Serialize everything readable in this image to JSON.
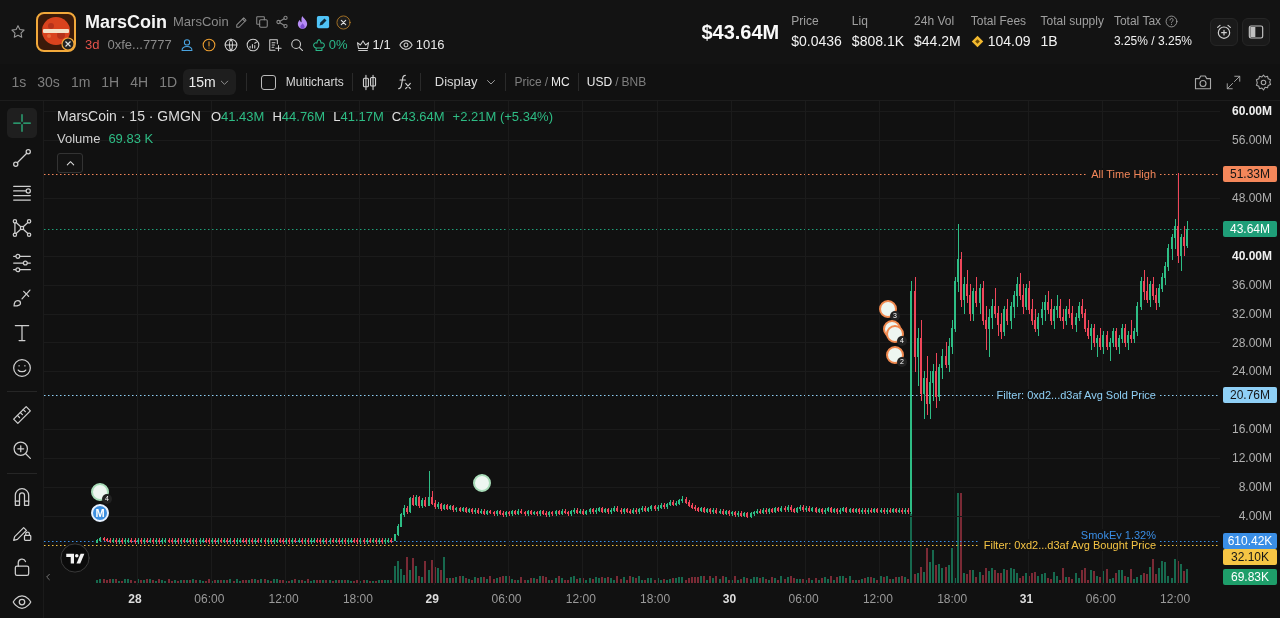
{
  "token": {
    "name": "MarsCoin",
    "symbol": "MarsCoin",
    "age": "3d",
    "address": "0xfe...7777",
    "holding_share": "0%",
    "ratio": "1/1",
    "views": "1016"
  },
  "market_cap": "$43.64M",
  "stats": [
    {
      "label": "Price",
      "value": "$0.0436"
    },
    {
      "label": "Liq",
      "value": "$808.1K"
    },
    {
      "label": "24h Vol",
      "value": "$44.2M"
    },
    {
      "label": "Total Fees",
      "value": "104.09",
      "kind": "coin"
    },
    {
      "label": "Total supply",
      "value": "1B"
    },
    {
      "label": "Total Tax",
      "value": "3.25% / 3.25%",
      "kind": "help"
    }
  ],
  "intervals": [
    {
      "label": "1s",
      "selected": false
    },
    {
      "label": "30s",
      "selected": false
    },
    {
      "label": "1m",
      "selected": false
    },
    {
      "label": "1H",
      "selected": false
    },
    {
      "label": "4H",
      "selected": false
    },
    {
      "label": "1D",
      "selected": false
    },
    {
      "label": "15m",
      "selected": true
    }
  ],
  "toolbar": {
    "multicharts": {
      "label": "Multicharts",
      "checked": false
    },
    "display": "Display",
    "price_mode": {
      "options": [
        {
          "label": "Price",
          "selected": false
        },
        {
          "label": "MC",
          "selected": true
        }
      ],
      "separator": "/"
    },
    "currency": {
      "options": [
        {
          "label": "USD",
          "selected": true
        },
        {
          "label": "BNB",
          "selected": false
        }
      ],
      "separator": "/"
    }
  },
  "drawing_tools": [
    {
      "selected": true
    },
    {
      "selected": false
    },
    {
      "selected": false
    },
    {
      "selected": false
    },
    {
      "selected": false
    },
    {
      "selected": false
    },
    {
      "selected": false
    },
    {
      "selected": false
    },
    {
      "selected": false
    },
    {
      "selected": false
    },
    {
      "selected": false
    },
    {
      "selected": false
    },
    {
      "selected": false
    },
    {
      "selected": false
    }
  ],
  "price_axis": [
    {
      "major": true
    },
    {
      "major": false
    },
    {
      "major": false
    },
    {
      "major": true
    },
    {
      "major": false
    },
    {
      "major": false
    },
    {
      "major": false
    },
    {
      "major": false
    },
    {
      "major": false
    },
    {
      "major": false
    },
    {
      "major": false
    },
    {
      "major": false
    }
  ],
  "time_axis": [
    {
      "major": true
    },
    {
      "major": false
    },
    {
      "major": false
    },
    {
      "major": false
    },
    {
      "major": true
    },
    {
      "major": false
    },
    {
      "major": false
    },
    {
      "major": false
    },
    {
      "major": true
    },
    {
      "major": false
    },
    {
      "major": false
    },
    {
      "major": false
    },
    {
      "major": true
    },
    {
      "major": false
    },
    {
      "major": false
    }
  ],
  "chart": {
    "legend": {
      "title": "MarsCoin · 15 · GMGN",
      "ohlc": [
        {
          "key": "O",
          "value": "41.43M"
        },
        {
          "key": "H",
          "value": "44.76M"
        },
        {
          "key": "L",
          "value": "41.17M"
        },
        {
          "key": "C",
          "value": "43.64M"
        }
      ],
      "change": "+2.21M (+5.34%)",
      "volume_label": "Volume",
      "volume_value": "69.83 K"
    },
    "chart_data": {
      "type": "candlestick",
      "grid": true,
      "ylim": [
        -5.53,
        61.39
      ],
      "yticks": [
        {
          "value": 60,
          "label": "60.00M"
        },
        {
          "value": 56,
          "label": "56.00M"
        },
        {
          "value": 48,
          "label": "48.00M"
        },
        {
          "value": 40,
          "label": "40.00M"
        },
        {
          "value": 36,
          "label": "36.00M"
        },
        {
          "value": 32,
          "label": "32.00M"
        },
        {
          "value": 28,
          "label": "28.00M"
        },
        {
          "value": 24,
          "label": "24.00M"
        },
        {
          "value": 16,
          "label": "16.00M"
        },
        {
          "value": 12,
          "label": "12.00M"
        },
        {
          "value": 8,
          "label": "8.00M"
        },
        {
          "value": 4,
          "label": "4.00M"
        }
      ],
      "categories": [
        null,
        null,
        null,
        null,
        null,
        null,
        null,
        null,
        null,
        null,
        null,
        null,
        "28",
        null,
        null,
        null,
        null,
        null,
        null,
        null,
        null,
        null,
        null,
        null,
        null,
        null,
        null,
        null,
        null,
        null,
        null,
        null,
        null,
        null,
        null,
        null,
        "06:00",
        null,
        null,
        null,
        null,
        null,
        null,
        null,
        null,
        null,
        null,
        null,
        null,
        null,
        null,
        null,
        null,
        null,
        null,
        null,
        null,
        null,
        null,
        null,
        "12:00",
        null,
        null,
        null,
        null,
        null,
        null,
        null,
        null,
        null,
        null,
        null,
        null,
        null,
        null,
        null,
        null,
        null,
        null,
        null,
        null,
        null,
        null,
        null,
        "18:00",
        null,
        null,
        null,
        null,
        null,
        null,
        null,
        null,
        null,
        null,
        null,
        null,
        null,
        null,
        null,
        null,
        null,
        null,
        null,
        null,
        null,
        null,
        null,
        "29",
        null,
        null,
        null,
        null,
        null,
        null,
        null,
        null,
        null,
        null,
        null,
        null,
        null,
        null,
        null,
        null,
        null,
        null,
        null,
        null,
        null,
        null,
        null,
        "06:00",
        null,
        null,
        null,
        null,
        null,
        null,
        null,
        null,
        null,
        null,
        null,
        null,
        null,
        null,
        null,
        null,
        null,
        null,
        null,
        null,
        null,
        null,
        null,
        "12:00",
        null,
        null,
        null,
        null,
        null,
        null,
        null,
        null,
        null,
        null,
        null,
        null,
        null,
        null,
        null,
        null,
        null,
        null,
        null,
        null,
        null,
        null,
        null,
        "18:00",
        null,
        null,
        null,
        null,
        null,
        null,
        null,
        null,
        null,
        null,
        null,
        null,
        null,
        null,
        null,
        null,
        null,
        null,
        null,
        null,
        null,
        null,
        null,
        "30",
        null,
        null,
        null,
        null,
        null,
        null,
        null,
        null,
        null,
        null,
        null,
        null,
        null,
        null,
        null,
        null,
        null,
        null,
        null,
        null,
        null,
        null,
        null,
        "06:00",
        null,
        null,
        null,
        null,
        null,
        null,
        null,
        null,
        null,
        null,
        null,
        null,
        null,
        null,
        null,
        null,
        null,
        null,
        null,
        null,
        null,
        null,
        null,
        "12:00",
        null,
        null,
        null,
        null,
        null,
        null,
        null,
        null,
        null,
        null,
        null,
        null,
        null,
        null,
        null,
        null,
        null,
        null,
        null,
        null,
        null,
        null,
        null,
        "18:00",
        null,
        null,
        null,
        null,
        null,
        null,
        null,
        null,
        null,
        null,
        null,
        null,
        null,
        null,
        null,
        null,
        null,
        null,
        null,
        null,
        null,
        null,
        null,
        "31",
        null,
        null,
        null,
        null,
        null,
        null,
        null,
        null,
        null,
        null,
        null,
        null,
        null,
        null,
        null,
        null,
        null,
        null,
        null,
        null,
        null,
        null,
        null,
        "06:00",
        null,
        null,
        null,
        null,
        null,
        null,
        null,
        null,
        null,
        null,
        null,
        null,
        null,
        null,
        null,
        null,
        null,
        null,
        null,
        null,
        null,
        null,
        null,
        "12:00",
        null,
        null,
        null,
        null
      ],
      "ohlc": [
        [
          0.4,
          0.8,
          0.3,
          0.6
        ],
        [
          0.6,
          1.1,
          0.5,
          0.88
        ],
        [
          0.88,
          1.1,
          0.6,
          0.74
        ],
        [
          0.74,
          0.95,
          0.45,
          0.59
        ],
        [
          0.59,
          0.89,
          0.28,
          0.58
        ],
        [
          0.58,
          0.91,
          0.28,
          0.61
        ],
        [
          0.61,
          0.91,
          0.27,
          0.57
        ],
        [
          0.57,
          0.9,
          0.27,
          0.6
        ],
        [
          0.6,
          0.9,
          0.25,
          0.55
        ],
        [
          0.55,
          0.89,
          0.25,
          0.59
        ],
        [
          0.59,
          0.92,
          0.29,
          0.62
        ],
        [
          0.62,
          0.92,
          0.28,
          0.58
        ],
        [
          0.58,
          0.88,
          0.26,
          0.56
        ],
        [
          0.56,
          0.9,
          0.26,
          0.6
        ],
        [
          0.6,
          0.9,
          0.27,
          0.57
        ],
        [
          0.57,
          0.89,
          0.27,
          0.59
        ],
        [
          0.59,
          0.89,
          0.28,
          0.58
        ],
        [
          0.58,
          0.91,
          0.28,
          0.61
        ],
        [
          0.61,
          0.91,
          0.27,
          0.57
        ],
        [
          0.57,
          0.9,
          0.27,
          0.6
        ],
        [
          0.6,
          0.9,
          0.25,
          0.55
        ],
        [
          0.55,
          0.89,
          0.25,
          0.59
        ],
        [
          0.59,
          0.92,
          0.29,
          0.62
        ],
        [
          0.62,
          0.92,
          0.28,
          0.58
        ],
        [
          0.58,
          0.88,
          0.26,
          0.56
        ],
        [
          0.56,
          0.9,
          0.26,
          0.6
        ],
        [
          0.6,
          0.9,
          0.27,
          0.57
        ],
        [
          0.57,
          0.89,
          0.27,
          0.59
        ],
        [
          0.59,
          0.89,
          0.28,
          0.58
        ],
        [
          0.58,
          0.91,
          0.28,
          0.61
        ],
        [
          0.61,
          0.91,
          0.27,
          0.57
        ],
        [
          0.57,
          0.9,
          0.27,
          0.6
        ],
        [
          0.6,
          0.9,
          0.25,
          0.55
        ],
        [
          0.55,
          0.89,
          0.25,
          0.59
        ],
        [
          0.59,
          0.92,
          0.29,
          0.62
        ],
        [
          0.62,
          0.92,
          0.28,
          0.58
        ],
        [
          0.58,
          0.88,
          0.26,
          0.56
        ],
        [
          0.56,
          0.9,
          0.26,
          0.6
        ],
        [
          0.6,
          0.9,
          0.27,
          0.57
        ],
        [
          0.57,
          0.89,
          0.27,
          0.59
        ],
        [
          0.59,
          0.89,
          0.28,
          0.58
        ],
        [
          0.58,
          0.91,
          0.28,
          0.61
        ],
        [
          0.61,
          0.91,
          0.27,
          0.57
        ],
        [
          0.57,
          0.9,
          0.27,
          0.6
        ],
        [
          0.6,
          0.9,
          0.25,
          0.55
        ],
        [
          0.55,
          0.89,
          0.25,
          0.59
        ],
        [
          0.59,
          0.92,
          0.29,
          0.62
        ],
        [
          0.62,
          0.92,
          0.28,
          0.58
        ],
        [
          0.58,
          0.88,
          0.26,
          0.56
        ],
        [
          0.56,
          0.9,
          0.26,
          0.6
        ],
        [
          0.6,
          0.9,
          0.27,
          0.57
        ],
        [
          0.57,
          0.89,
          0.27,
          0.59
        ],
        [
          0.59,
          0.89,
          0.28,
          0.58
        ],
        [
          0.58,
          0.91,
          0.28,
          0.61
        ],
        [
          0.61,
          0.91,
          0.27,
          0.57
        ],
        [
          0.57,
          0.9,
          0.27,
          0.6
        ],
        [
          0.6,
          0.9,
          0.25,
          0.55
        ],
        [
          0.55,
          0.89,
          0.25,
          0.59
        ],
        [
          0.59,
          0.92,
          0.29,
          0.62
        ],
        [
          0.62,
          0.92,
          0.28,
          0.58
        ],
        [
          0.58,
          0.88,
          0.26,
          0.56
        ],
        [
          0.56,
          0.9,
          0.26,
          0.6
        ],
        [
          0.6,
          0.9,
          0.27,
          0.57
        ],
        [
          0.57,
          0.89,
          0.27,
          0.59
        ],
        [
          0.59,
          0.89,
          0.28,
          0.58
        ],
        [
          0.58,
          0.91,
          0.28,
          0.61
        ],
        [
          0.61,
          0.91,
          0.27,
          0.57
        ],
        [
          0.57,
          0.9,
          0.27,
          0.6
        ],
        [
          0.6,
          0.9,
          0.25,
          0.55
        ],
        [
          0.55,
          0.89,
          0.25,
          0.59
        ],
        [
          0.59,
          0.92,
          0.29,
          0.62
        ],
        [
          0.62,
          0.92,
          0.28,
          0.58
        ],
        [
          0.58,
          0.88,
          0.26,
          0.56
        ],
        [
          0.56,
          0.9,
          0.26,
          0.6
        ],
        [
          0.6,
          0.9,
          0.27,
          0.57
        ],
        [
          0.57,
          0.89,
          0.27,
          0.59
        ],
        [
          0.59,
          0.89,
          0.28,
          0.58
        ],
        [
          0.58,
          0.91,
          0.28,
          0.61
        ],
        [
          0.61,
          0.91,
          0.27,
          0.57
        ],
        [
          0.57,
          0.9,
          0.27,
          0.6
        ],
        [
          0.6,
          0.9,
          0.25,
          0.55
        ],
        [
          0.55,
          0.89,
          0.25,
          0.59
        ],
        [
          0.59,
          0.92,
          0.29,
          0.62
        ],
        [
          0.62,
          0.92,
          0.28,
          0.58
        ],
        [
          0.58,
          0.88,
          0.26,
          0.56
        ],
        [
          0.56,
          0.9,
          0.26,
          0.6
        ],
        [
          0.6,
          0.9,
          0.27,
          0.57
        ],
        [
          0.57,
          0.89,
          0.27,
          0.59
        ],
        [
          0.59,
          0.89,
          0.28,
          0.58
        ],
        [
          0.58,
          0.91,
          0.28,
          0.61
        ],
        [
          0.61,
          0.91,
          0.27,
          0.57
        ],
        [
          0.57,
          0.9,
          0.27,
          0.6
        ],
        [
          0.6,
          0.9,
          0.25,
          0.55
        ],
        [
          0.55,
          0.89,
          0.25,
          0.59
        ],
        [
          0.59,
          0.92,
          0.29,
          0.62
        ],
        [
          0.62,
          0.92,
          0.28,
          0.58
        ],
        [
          0.58,
          1.5,
          0.56,
          1.4
        ],
        [
          1.4,
          2.8,
          1.3,
          2.6
        ],
        [
          2.6,
          4.4,
          2.5,
          4.2
        ],
        [
          4.2,
          5.4,
          4.0,
          5.1
        ],
        [
          5.1,
          5.3,
          4.3,
          4.6
        ],
        [
          4.6,
          6.6,
          4.5,
          6.4
        ],
        [
          6.4,
          6.9,
          5.4,
          5.6
        ],
        [
          5.6,
          6.8,
          5.4,
          6.5
        ],
        [
          6.5,
          6.7,
          5.2,
          5.4
        ],
        [
          5.4,
          6.4,
          5.2,
          6.2
        ],
        [
          6.2,
          6.5,
          5.3,
          5.5
        ],
        [
          5.5,
          10.2,
          5.4,
          6.6
        ],
        [
          6.6,
          7.4,
          5.6,
          5.8
        ],
        [
          5.8,
          6.1,
          5.1,
          5.3
        ],
        [
          5.3,
          5.9,
          5.1,
          5.6
        ],
        [
          5.6,
          5.8,
          4.8,
          5.0
        ],
        [
          5.0,
          5.6,
          4.9,
          5.4
        ],
        [
          5.4,
          5.6,
          4.9,
          5.1
        ],
        [
          5.1,
          5.5,
          4.9,
          5.3
        ],
        [
          5.3,
          5.5,
          4.7,
          4.9
        ],
        [
          4.9,
          5.2,
          4.7,
          5.0
        ],
        [
          5.0,
          5.2,
          4.6,
          4.8
        ],
        [
          4.8,
          5.2,
          4.6,
          5.0
        ],
        [
          5.0,
          5.2,
          4.5,
          4.7
        ],
        [
          4.7,
          5.1,
          4.5,
          4.9
        ],
        [
          4.9,
          5.1,
          4.4,
          4.6
        ],
        [
          4.6,
          5.0,
          4.4,
          4.8
        ],
        [
          4.8,
          5.0,
          4.3,
          4.5
        ],
        [
          4.5,
          4.9,
          4.3,
          4.7
        ],
        [
          4.7,
          4.9,
          4.2,
          4.4
        ],
        [
          4.4,
          4.8,
          4.2,
          4.6
        ],
        [
          4.6,
          4.8,
          4.3,
          4.5
        ],
        [
          4.5,
          4.7,
          4.1,
          4.3
        ],
        [
          4.3,
          4.8,
          4.1,
          4.6
        ],
        [
          4.6,
          4.8,
          4.2,
          4.4
        ],
        [
          4.4,
          4.6,
          4.0,
          4.2
        ],
        [
          4.2,
          4.7,
          4.0,
          4.5
        ],
        [
          4.5,
          4.7,
          4.1,
          4.3
        ],
        [
          4.3,
          4.8,
          4.1,
          4.6
        ],
        [
          4.6,
          4.8,
          4.2,
          4.4
        ],
        [
          4.4,
          4.9,
          4.2,
          4.7
        ],
        [
          4.7,
          4.9,
          4.3,
          4.5
        ],
        [
          4.5,
          4.7,
          4.1,
          4.3
        ],
        [
          4.3,
          4.8,
          4.1,
          4.6
        ],
        [
          4.6,
          4.8,
          4.2,
          4.4
        ],
        [
          4.4,
          4.7,
          4.2,
          4.5
        ],
        [
          4.5,
          4.7,
          4.1,
          4.3
        ],
        [
          4.3,
          4.8,
          4.1,
          4.6
        ],
        [
          4.6,
          4.8,
          4.2,
          4.4
        ],
        [
          4.4,
          4.6,
          4.0,
          4.2
        ],
        [
          4.2,
          4.7,
          4.0,
          4.5
        ],
        [
          4.5,
          4.7,
          4.1,
          4.3
        ],
        [
          4.3,
          4.8,
          4.1,
          4.6
        ],
        [
          4.6,
          4.8,
          4.2,
          4.4
        ],
        [
          4.4,
          4.9,
          4.2,
          4.7
        ],
        [
          4.7,
          4.9,
          4.3,
          4.5
        ],
        [
          4.5,
          4.7,
          4.1,
          4.3
        ],
        [
          4.3,
          4.8,
          4.1,
          4.6
        ],
        [
          4.6,
          5.0,
          4.4,
          4.8
        ],
        [
          4.8,
          5.0,
          4.3,
          4.5
        ],
        [
          4.5,
          4.9,
          4.3,
          4.7
        ],
        [
          4.7,
          4.9,
          4.2,
          4.4
        ],
        [
          4.4,
          4.8,
          4.2,
          4.6
        ],
        [
          4.6,
          5.1,
          4.4,
          4.9
        ],
        [
          4.9,
          5.1,
          4.4,
          4.6
        ],
        [
          4.6,
          5.0,
          4.4,
          4.8
        ],
        [
          4.8,
          5.2,
          4.6,
          5.0
        ],
        [
          5.0,
          5.2,
          4.5,
          4.7
        ],
        [
          4.7,
          5.1,
          4.5,
          4.9
        ],
        [
          4.9,
          5.1,
          4.4,
          4.6
        ],
        [
          4.6,
          5.0,
          4.4,
          4.8
        ],
        [
          4.8,
          5.3,
          4.6,
          5.1
        ],
        [
          5.1,
          5.3,
          4.6,
          4.8
        ],
        [
          4.8,
          5.0,
          4.4,
          4.6
        ],
        [
          4.6,
          5.1,
          4.4,
          4.9
        ],
        [
          4.9,
          5.1,
          4.5,
          4.7
        ],
        [
          4.7,
          4.9,
          4.3,
          4.5
        ],
        [
          4.5,
          5.0,
          4.3,
          4.8
        ],
        [
          4.8,
          5.0,
          4.4,
          4.6
        ],
        [
          4.6,
          5.1,
          4.4,
          4.9
        ],
        [
          4.9,
          5.3,
          4.7,
          5.1
        ],
        [
          5.1,
          5.3,
          4.6,
          4.8
        ],
        [
          4.8,
          5.2,
          4.6,
          5.0
        ],
        [
          5.0,
          5.5,
          4.8,
          5.3
        ],
        [
          5.3,
          5.5,
          4.8,
          5.0
        ],
        [
          5.0,
          5.4,
          4.8,
          5.2
        ],
        [
          5.2,
          5.7,
          5.0,
          5.5
        ],
        [
          5.5,
          5.7,
          5.1,
          5.3
        ],
        [
          5.3,
          5.8,
          5.1,
          5.6
        ],
        [
          5.6,
          6.1,
          5.4,
          5.9
        ],
        [
          5.9,
          6.1,
          5.4,
          5.6
        ],
        [
          5.6,
          6.0,
          5.4,
          5.8
        ],
        [
          5.8,
          6.3,
          5.6,
          6.1
        ],
        [
          6.1,
          6.7,
          5.9,
          6.3
        ],
        [
          6.3,
          6.5,
          5.7,
          5.9
        ],
        [
          5.9,
          6.1,
          5.3,
          5.5
        ],
        [
          5.5,
          5.7,
          5.0,
          5.2
        ],
        [
          5.2,
          5.4,
          4.8,
          5.0
        ],
        [
          5.0,
          5.2,
          4.6,
          4.8
        ],
        [
          4.8,
          5.2,
          4.6,
          5.0
        ],
        [
          5.0,
          5.2,
          4.5,
          4.7
        ],
        [
          4.7,
          5.1,
          4.5,
          4.9
        ],
        [
          4.9,
          5.1,
          4.4,
          4.6
        ],
        [
          4.6,
          5.0,
          4.4,
          4.8
        ],
        [
          4.8,
          5.0,
          4.3,
          4.5
        ],
        [
          4.5,
          4.9,
          4.3,
          4.7
        ],
        [
          4.7,
          4.9,
          4.2,
          4.4
        ],
        [
          4.4,
          4.8,
          4.2,
          4.6
        ],
        [
          4.6,
          4.8,
          4.1,
          4.3
        ],
        [
          4.3,
          4.7,
          4.1,
          4.5
        ],
        [
          4.5,
          4.7,
          4.0,
          4.2
        ],
        [
          4.2,
          4.6,
          4.0,
          4.4
        ],
        [
          4.4,
          4.6,
          3.9,
          4.1
        ],
        [
          4.1,
          4.5,
          3.9,
          4.3
        ],
        [
          4.3,
          4.5,
          3.8,
          4.0
        ],
        [
          4.0,
          4.5,
          3.8,
          4.3
        ],
        [
          4.3,
          4.7,
          4.1,
          4.5
        ],
        [
          4.5,
          4.9,
          4.3,
          4.7
        ],
        [
          4.7,
          4.9,
          4.3,
          4.5
        ],
        [
          4.5,
          5.0,
          4.3,
          4.8
        ],
        [
          4.8,
          5.0,
          4.4,
          4.6
        ],
        [
          4.6,
          5.1,
          4.4,
          4.9
        ],
        [
          4.9,
          5.1,
          4.5,
          4.7
        ],
        [
          4.7,
          5.2,
          4.5,
          5.0
        ],
        [
          5.0,
          5.2,
          4.6,
          4.8
        ],
        [
          4.8,
          5.3,
          4.6,
          5.1
        ],
        [
          5.1,
          5.3,
          4.7,
          4.9
        ],
        [
          4.9,
          5.4,
          4.7,
          5.2
        ],
        [
          5.2,
          5.4,
          4.7,
          4.9
        ],
        [
          4.9,
          5.1,
          4.5,
          4.7
        ],
        [
          4.7,
          5.2,
          4.5,
          5.0
        ],
        [
          5.0,
          5.4,
          4.8,
          5.2
        ],
        [
          5.2,
          5.4,
          4.7,
          4.9
        ],
        [
          4.9,
          5.3,
          4.7,
          5.1
        ],
        [
          5.1,
          5.3,
          4.6,
          4.8
        ],
        [
          4.8,
          5.2,
          4.6,
          5.0
        ],
        [
          5.0,
          5.2,
          4.5,
          4.7
        ],
        [
          4.7,
          5.1,
          4.5,
          4.9
        ],
        [
          4.9,
          5.1,
          4.4,
          4.6
        ],
        [
          4.6,
          5.0,
          4.4,
          4.8
        ],
        [
          4.8,
          5.2,
          4.6,
          5.0
        ],
        [
          5.0,
          5.2,
          4.5,
          4.7
        ],
        [
          4.7,
          5.1,
          4.5,
          4.9
        ],
        [
          4.9,
          5.1,
          4.4,
          4.6
        ],
        [
          4.6,
          5.0,
          4.4,
          4.8
        ],
        [
          4.8,
          5.2,
          4.6,
          5.0
        ],
        [
          5.0,
          5.2,
          4.5,
          4.7
        ],
        [
          4.7,
          5.1,
          4.5,
          4.9
        ],
        [
          4.9,
          5.1,
          4.5,
          4.7
        ],
        [
          4.7,
          5.1,
          4.5,
          4.9
        ],
        [
          4.9,
          5.1,
          4.4,
          4.6
        ],
        [
          4.6,
          5.0,
          4.4,
          4.8
        ],
        [
          4.8,
          5.0,
          4.4,
          4.6
        ],
        [
          4.6,
          5.0,
          4.4,
          4.8
        ],
        [
          4.8,
          5.0,
          4.5,
          4.7
        ],
        [
          4.7,
          5.1,
          4.5,
          4.9
        ],
        [
          4.9,
          5.1,
          4.5,
          4.7
        ],
        [
          4.7,
          5.0,
          4.5,
          4.8
        ],
        [
          4.8,
          5.0,
          4.4,
          4.6
        ],
        [
          4.6,
          5.0,
          4.4,
          4.8
        ],
        [
          4.8,
          5.0,
          4.5,
          4.7
        ],
        [
          4.7,
          5.1,
          4.5,
          4.9
        ],
        [
          4.9,
          5.1,
          4.5,
          4.7
        ],
        [
          4.7,
          5.0,
          4.5,
          4.8
        ],
        [
          4.8,
          5.0,
          4.4,
          4.6
        ],
        [
          4.6,
          5.0,
          4.4,
          4.8
        ],
        [
          4.8,
          5.0,
          4.4,
          4.6
        ],
        [
          4.6,
          36.5,
          4.4,
          35
        ],
        [
          35,
          37,
          24,
          26
        ],
        [
          26,
          30,
          22,
          28.5
        ],
        [
          28.5,
          31,
          20,
          21
        ],
        [
          21,
          24,
          17.5,
          23
        ],
        [
          23,
          26,
          18,
          19.5
        ],
        [
          19.5,
          24,
          17.5,
          22.5
        ],
        [
          22.5,
          25,
          20,
          24
        ],
        [
          24,
          26.5,
          19,
          20.5
        ],
        [
          20.5,
          25,
          20,
          24.5
        ],
        [
          24.5,
          27,
          23,
          26
        ],
        [
          26,
          28,
          24.5,
          25
        ],
        [
          25,
          28.5,
          24,
          27.5
        ],
        [
          27.5,
          31,
          26.5,
          30
        ],
        [
          30,
          37,
          29.5,
          36.5
        ],
        [
          36.5,
          44.3,
          35,
          39.5
        ],
        [
          39.5,
          40.5,
          33,
          34
        ],
        [
          34,
          37,
          32,
          36
        ],
        [
          36,
          38,
          33.5,
          34.5
        ],
        [
          34.5,
          36,
          31,
          32
        ],
        [
          32,
          35.5,
          31,
          35
        ],
        [
          35,
          37,
          33,
          33.5
        ],
        [
          33.5,
          36,
          32,
          35.5
        ],
        [
          35.5,
          36.5,
          30.5,
          31
        ],
        [
          31,
          33,
          27,
          30
        ],
        [
          30,
          32.5,
          26,
          31.5
        ],
        [
          31.5,
          34,
          30,
          33
        ],
        [
          33,
          35.5,
          31.5,
          32
        ],
        [
          32,
          33,
          29,
          30.5
        ],
        [
          30.5,
          32,
          28.5,
          29.5
        ],
        [
          29.5,
          33,
          29,
          32.5
        ],
        [
          32.5,
          34,
          30.5,
          31
        ],
        [
          31,
          33.5,
          30,
          33
        ],
        [
          33,
          35,
          31.5,
          34.5
        ],
        [
          34.5,
          37,
          33,
          36
        ],
        [
          36,
          37.5,
          34,
          34.5
        ],
        [
          34.5,
          36,
          32,
          33
        ],
        [
          33,
          36,
          32.5,
          35.5
        ],
        [
          35.5,
          36.5,
          32,
          32.5
        ],
        [
          32.5,
          34,
          30.5,
          31
        ],
        [
          31,
          32.5,
          29.5,
          30
        ],
        [
          30,
          32,
          29,
          31.5
        ],
        [
          31.5,
          33.5,
          30.5,
          32.5
        ],
        [
          32.5,
          34.5,
          31,
          33.5
        ],
        [
          33.5,
          35,
          32,
          32.5
        ],
        [
          32.5,
          34,
          30.5,
          31
        ],
        [
          31,
          33,
          30,
          32.5
        ],
        [
          32.5,
          34.5,
          31.5,
          33
        ],
        [
          33,
          34,
          31,
          31.5
        ],
        [
          31.5,
          32.5,
          30,
          31
        ],
        [
          31,
          33,
          30.5,
          32.5
        ],
        [
          32.5,
          34,
          31.5,
          32
        ],
        [
          32,
          33,
          30,
          30.5
        ],
        [
          30.5,
          32,
          29.5,
          31.5
        ],
        [
          31.5,
          33.5,
          31,
          33
        ],
        [
          33,
          34,
          31.5,
          32
        ],
        [
          32,
          32.5,
          29.5,
          30
        ],
        [
          30,
          31,
          28.5,
          29
        ],
        [
          29,
          30.5,
          27,
          30
        ],
        [
          30,
          30.5,
          27.5,
          28
        ],
        [
          28,
          29,
          26,
          28.5
        ],
        [
          28.5,
          30,
          27,
          27.5
        ],
        [
          27.5,
          29.5,
          26.5,
          29
        ],
        [
          29,
          29.5,
          27,
          27.5
        ],
        [
          27.5,
          28.5,
          25.5,
          28
        ],
        [
          28,
          30,
          27.5,
          29.5
        ],
        [
          29.5,
          30,
          27,
          27.5
        ],
        [
          27.5,
          29,
          26.5,
          28.5
        ],
        [
          28.5,
          30.5,
          28,
          30
        ],
        [
          30,
          30.5,
          27.5,
          28
        ],
        [
          28,
          29.5,
          27,
          29
        ],
        [
          29,
          31,
          28,
          28.5
        ],
        [
          28.5,
          30,
          28,
          29.5
        ],
        [
          29.5,
          33.5,
          29,
          33
        ],
        [
          33,
          37,
          32.5,
          36.5
        ],
        [
          36.5,
          38,
          34,
          35
        ],
        [
          35,
          37,
          33.5,
          34
        ],
        [
          34,
          36.5,
          33,
          36
        ],
        [
          36,
          37,
          34,
          34.5
        ],
        [
          34.5,
          35.5,
          32.5,
          33.5
        ],
        [
          33.5,
          36,
          33,
          35.5
        ],
        [
          35.5,
          37.5,
          35,
          37
        ],
        [
          37,
          39,
          36,
          38.5
        ],
        [
          38.5,
          41.5,
          38,
          41
        ],
        [
          41,
          43,
          39.5,
          42.5
        ],
        [
          42.5,
          45,
          41,
          44
        ],
        [
          44,
          51.33,
          39,
          40
        ],
        [
          40,
          43,
          38,
          42.5
        ],
        [
          42.5,
          44,
          40,
          41.43
        ],
        [
          41.43,
          44.76,
          41.17,
          43.64
        ]
      ]
    },
    "price_lines": [
      {
        "text": "All Time High",
        "badge": "51.33M",
        "color": "#f4875a"
      },
      {
        "badge": "43.64M",
        "color": "#1f9e78"
      },
      {
        "text": "Filter: 0xd2...d3af Avg Sold Price",
        "badge": "20.76M",
        "color": "#8fd0f6"
      },
      {
        "text": "SmokEy 1.32%",
        "badge": "610.42K",
        "color": "#3a8ee6"
      },
      {
        "text": "Filter: 0xd2...d3af Avg Bought Price",
        "badge": "32.10K",
        "color": "#f6c544"
      }
    ],
    "volume_badge": {
      "value": "69.83K",
      "color": "#1e9e6a"
    },
    "markers": [
      {
        "kind": "avatar",
        "badge": "4",
        "color": "#a8dcb8"
      },
      {
        "kind": "letter",
        "text": "M",
        "color": "#3d8fe0"
      },
      {
        "kind": "avatar",
        "color": "#a8dcb8"
      },
      {
        "kind": "avatar",
        "badge": "3",
        "color": "#f0884e"
      },
      {
        "kind": "avatar",
        "color": "#f0884e"
      },
      {
        "kind": "avatar",
        "badge": "4",
        "color": "#f0884e"
      },
      {
        "kind": "avatar",
        "badge": "2",
        "color": "#f0884e"
      }
    ]
  }
}
